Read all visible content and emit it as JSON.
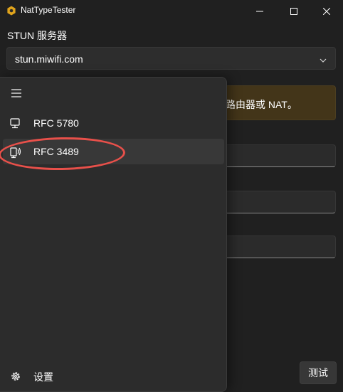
{
  "window": {
    "title": "NatTypeTester",
    "icons": [
      "app-hex-icon",
      "minimize-icon",
      "maximize-icon",
      "close-icon"
    ]
  },
  "stun": {
    "label": "STUN 服务器",
    "value": "stun.miwifi.com"
  },
  "warning": {
    "text": "路由器或 NAT。"
  },
  "nav": {
    "items": [
      {
        "label": "RFC 5780",
        "icon": "computer-icon"
      },
      {
        "label": "RFC 3489",
        "icon": "computer-signal-icon",
        "selected": true
      },
      {
        "label": "设置",
        "icon": "gear-icon"
      }
    ]
  },
  "actions": {
    "test_label": "测试"
  },
  "colors": {
    "background": "#202020",
    "pane": "#2c2c2c",
    "warning_bg": "#433519",
    "annotation": "#e8504a"
  }
}
